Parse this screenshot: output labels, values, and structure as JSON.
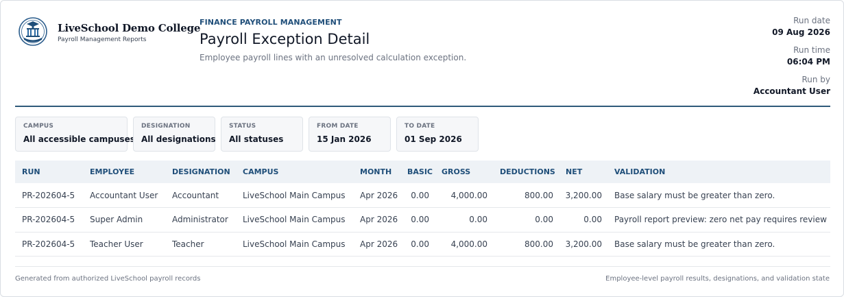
{
  "brand": {
    "name": "LiveSchool Demo College",
    "subtitle": "Payroll Management Reports"
  },
  "report": {
    "eyebrow": "FINANCE PAYROLL MANAGEMENT",
    "title": "Payroll Exception Detail",
    "subtitle": "Employee payroll lines with an unresolved calculation exception."
  },
  "meta": {
    "run_date_label": "Run date",
    "run_date": "09 Aug 2026",
    "run_time_label": "Run time",
    "run_time": "06:04 PM",
    "run_by_label": "Run by",
    "run_by": "Accountant User"
  },
  "filters": [
    {
      "label": "CAMPUS",
      "value": "All accessible campuses"
    },
    {
      "label": "DESIGNATION",
      "value": "All designations"
    },
    {
      "label": "STATUS",
      "value": "All statuses"
    },
    {
      "label": "FROM DATE",
      "value": "15 Jan 2026"
    },
    {
      "label": "TO DATE",
      "value": "01 Sep 2026"
    }
  ],
  "table": {
    "columns": [
      "RUN",
      "EMPLOYEE",
      "DESIGNATION",
      "CAMPUS",
      "MONTH",
      "BASIC",
      "GROSS",
      "DEDUCTIONS",
      "NET",
      "VALIDATION"
    ],
    "rows": [
      [
        "PR-202604-5",
        "Accountant User",
        "Accountant",
        "LiveSchool Main Campus",
        "Apr 2026",
        "0.00",
        "4,000.00",
        "800.00",
        "3,200.00",
        "Base salary must be greater than zero."
      ],
      [
        "PR-202604-5",
        "Super Admin",
        "Administrator",
        "LiveSchool Main Campus",
        "Apr 2026",
        "0.00",
        "0.00",
        "0.00",
        "0.00",
        "Payroll report preview: zero net pay requires review"
      ],
      [
        "PR-202604-5",
        "Teacher User",
        "Teacher",
        "LiveSchool Main Campus",
        "Apr 2026",
        "0.00",
        "4,000.00",
        "800.00",
        "3,200.00",
        "Base salary must be greater than zero."
      ]
    ]
  },
  "footer": {
    "left": "Generated from authorized LiveSchool payroll records",
    "right": "Employee-level payroll results, designations, and validation state"
  },
  "colors": {
    "accent": "#1f4e79",
    "divider": "#2e5a7a"
  },
  "icons": {
    "logo": "college-crest-icon"
  }
}
